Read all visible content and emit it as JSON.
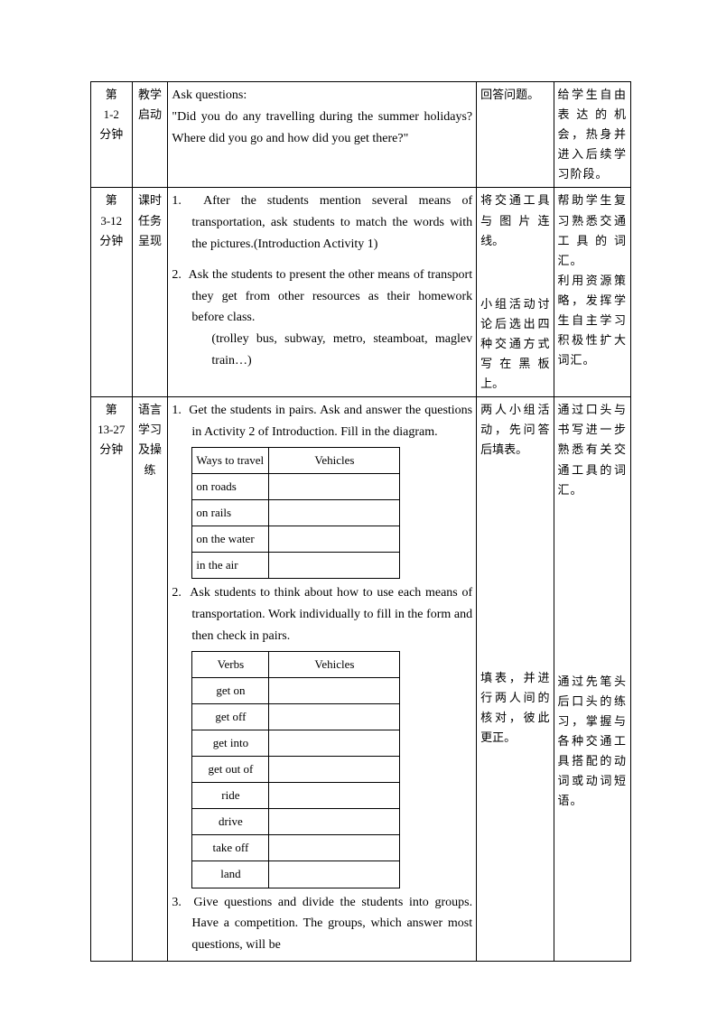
{
  "rows": [
    {
      "time": "第\n1-2\n分钟",
      "label": "教学启动",
      "content_intro": "Ask questions:",
      "content_q": "\"Did you do any travelling during the summer holidays? Where did you go and how did you get there?\"",
      "activity": "回答问题。",
      "purpose": "给学生自由表达的机会，热身并进入后续学习阶段。"
    },
    {
      "time": "第\n3-12\n分钟",
      "label": "课时任务呈现",
      "item1": "After the students mention several means of transportation, ask students to match the words with the pictures.(Introduction Activity 1)",
      "item2a": "Ask the students to present the other means of transport they get from other resources as their homework before class.",
      "item2b": "(trolley bus, subway, metro, steamboat, maglev train…)",
      "activity1": "将交通工具与图片连线。",
      "activity2": "小组活动讨论后选出四种交通方式写在黑板上。",
      "purpose1": "帮助学生复习熟悉交通工具的词汇。",
      "purpose2": "利用资源策略，发挥学生自主学习积极性扩大词汇。"
    },
    {
      "time": "第\n13-27\n分钟",
      "label": "语言学习及操练",
      "item1": "Get the students in pairs. Ask and answer the questions in Activity 2 of Introduction. Fill in the diagram.",
      "tbl1_h1": "Ways to travel",
      "tbl1_h2": "Vehicles",
      "tbl1_r1": "on roads",
      "tbl1_r2": "on rails",
      "tbl1_r3": "on the water",
      "tbl1_r4": "in the air",
      "item2": "Ask students to think about how to use each means of transportation. Work individually to fill in the form and then check in pairs.",
      "tbl2_h1": "Verbs",
      "tbl2_h2": "Vehicles",
      "tbl2_r1": "get on",
      "tbl2_r2": "get off",
      "tbl2_r3": "get into",
      "tbl2_r4": "get out of",
      "tbl2_r5": "ride",
      "tbl2_r6": "drive",
      "tbl2_r7": "take off",
      "tbl2_r8": "land",
      "item3": "Give questions and divide the students into groups. Have a competition. The groups, which answer most questions, will be",
      "activity1": "两人小组活动，先问答后填表。",
      "activity2": "填表，并进行两人间的核对，彼此更正。",
      "purpose1": "通过口头与书写进一步熟悉有关交通工具的词汇。",
      "purpose2": "通过先笔头后口头的练习，掌握与各种交通工具搭配的动词或动词短语。"
    }
  ]
}
